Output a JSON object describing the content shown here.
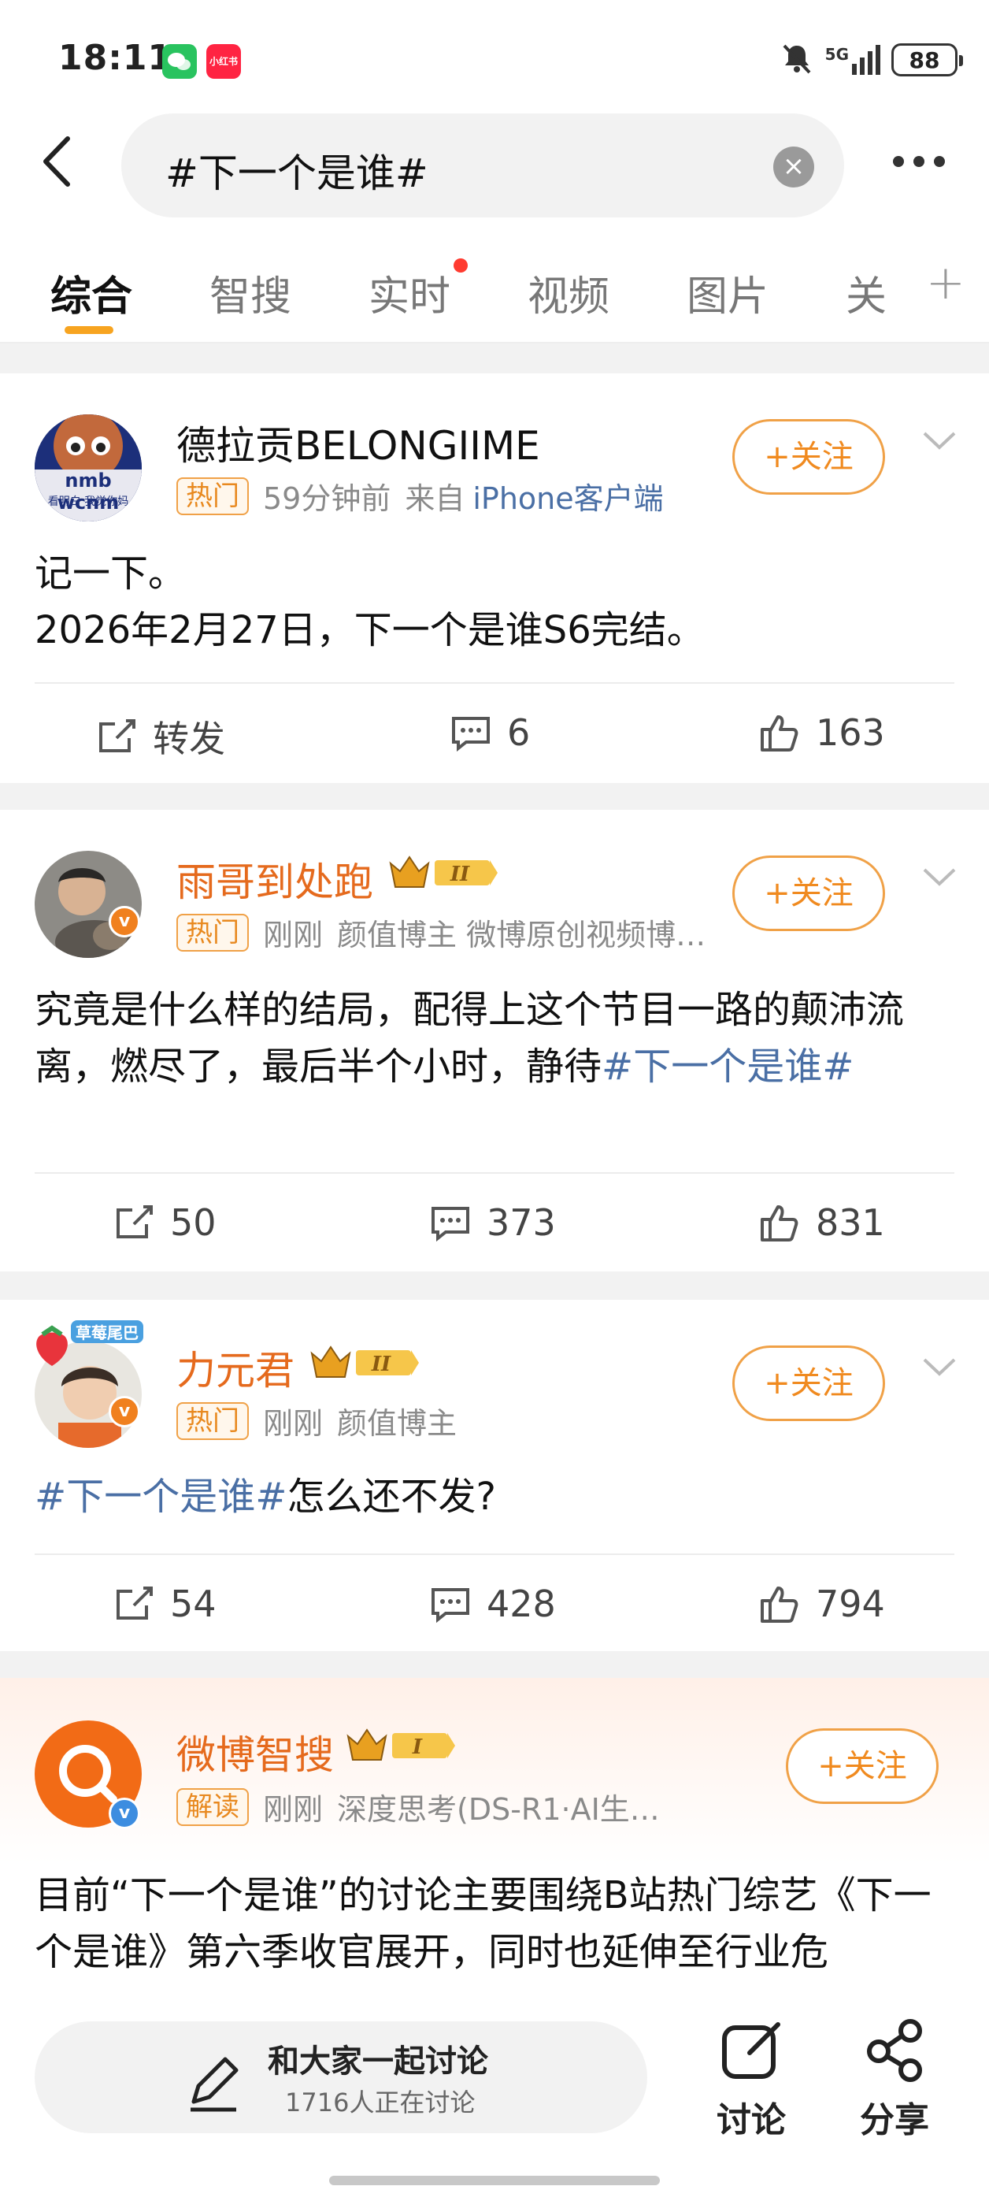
{
  "status_bar": {
    "time": "18:11",
    "battery": "88",
    "network": "5G",
    "xhs_badge": "小红书"
  },
  "search": {
    "query": "#下一个是谁#"
  },
  "tabs": [
    {
      "label": "综合",
      "active": true
    },
    {
      "label": "智搜"
    },
    {
      "label": "实时",
      "dot": true
    },
    {
      "label": "视频"
    },
    {
      "label": "图片"
    },
    {
      "label": "关"
    }
  ],
  "follow_label": "+关注",
  "posts": [
    {
      "author": "德拉贡BELONGIIME",
      "avatar_text": "nmb wcnm",
      "avatar_sub": "看明白 我觉你妈",
      "tag": "热门",
      "time": "59分钟前",
      "source_prefix": "来自",
      "source": "iPhone客户端",
      "content_line1": "记一下。",
      "content_line2": "2026年2月27日，下一个是谁S6完结。",
      "repost": "转发",
      "comments": "6",
      "likes": "163"
    },
    {
      "author": "雨哥到处跑",
      "tag": "热门",
      "time": "刚刚",
      "desc": "颜值博主 微博原创视频博…",
      "content_a": "究竟是什么样的结局，配得上这个节目一路的颠沛流离，燃尽了，最后半个小时，静待",
      "content_hashtag": "#下一个是谁#",
      "reposts": "50",
      "comments": "373",
      "likes": "831"
    },
    {
      "author": "力元君",
      "tag": "热门",
      "time": "刚刚",
      "desc": "颜值博主",
      "avatar_sticker": "草莓尾巴",
      "content_hashtag": "#下一个是谁#",
      "content_b": "怎么还不发?",
      "reposts": "54",
      "comments": "428",
      "likes": "794"
    }
  ],
  "ai_card": {
    "author": "微博智搜",
    "tag": "解读",
    "time": "刚刚",
    "desc": "深度思考(DS-R1·AI生…",
    "content": "目前“下一个是谁”的讨论主要围绕B站热门综艺《下一个是谁》第六季收官展开，同时也延伸至行业危"
  },
  "bottom_bar": {
    "discuss_title": "和大家一起讨论",
    "discuss_sub": "1716人正在讨论",
    "discuss_btn": "讨论",
    "share_btn": "分享"
  }
}
